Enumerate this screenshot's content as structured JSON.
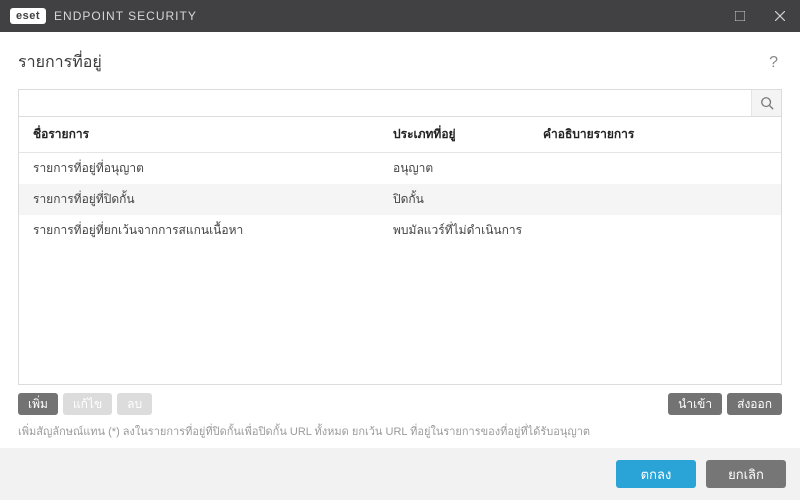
{
  "titlebar": {
    "brand_badge": "eset",
    "brand_name": "ENDPOINT SECURITY"
  },
  "page": {
    "title": "รายการที่อยู่",
    "help": "?"
  },
  "search": {
    "value": "",
    "placeholder": ""
  },
  "columns": {
    "name": "ชื่อรายการ",
    "type": "ประเภทที่อยู่",
    "desc": "คำอธิบายรายการ"
  },
  "rows": [
    {
      "name": "รายการที่อยู่ที่อนุญาต",
      "type": "อนุญาต",
      "desc": ""
    },
    {
      "name": "รายการที่อยู่ที่ปิดกั้น",
      "type": "ปิดกั้น",
      "desc": ""
    },
    {
      "name": "รายการที่อยู่ที่ยกเว้นจากการสแกนเนื้อหา",
      "type": "พบมัลแวร์ที่ไม่ดำเนินการ",
      "desc": ""
    }
  ],
  "toolbar": {
    "add": "เพิ่ม",
    "edit": "แก้ไข",
    "delete": "ลบ",
    "import": "นำเข้า",
    "export": "ส่งออก"
  },
  "hint": "เพิ่มสัญลักษณ์แทน (*) ลงในรายการที่อยู่ที่ปิดกั้นเพื่อปิดกั้น URL ทั้งหมด ยกเว้น URL ที่อยู่ในรายการของที่อยู่ที่ได้รับอนุญาต",
  "footer": {
    "ok": "ตกลง",
    "cancel": "ยกเลิก"
  }
}
